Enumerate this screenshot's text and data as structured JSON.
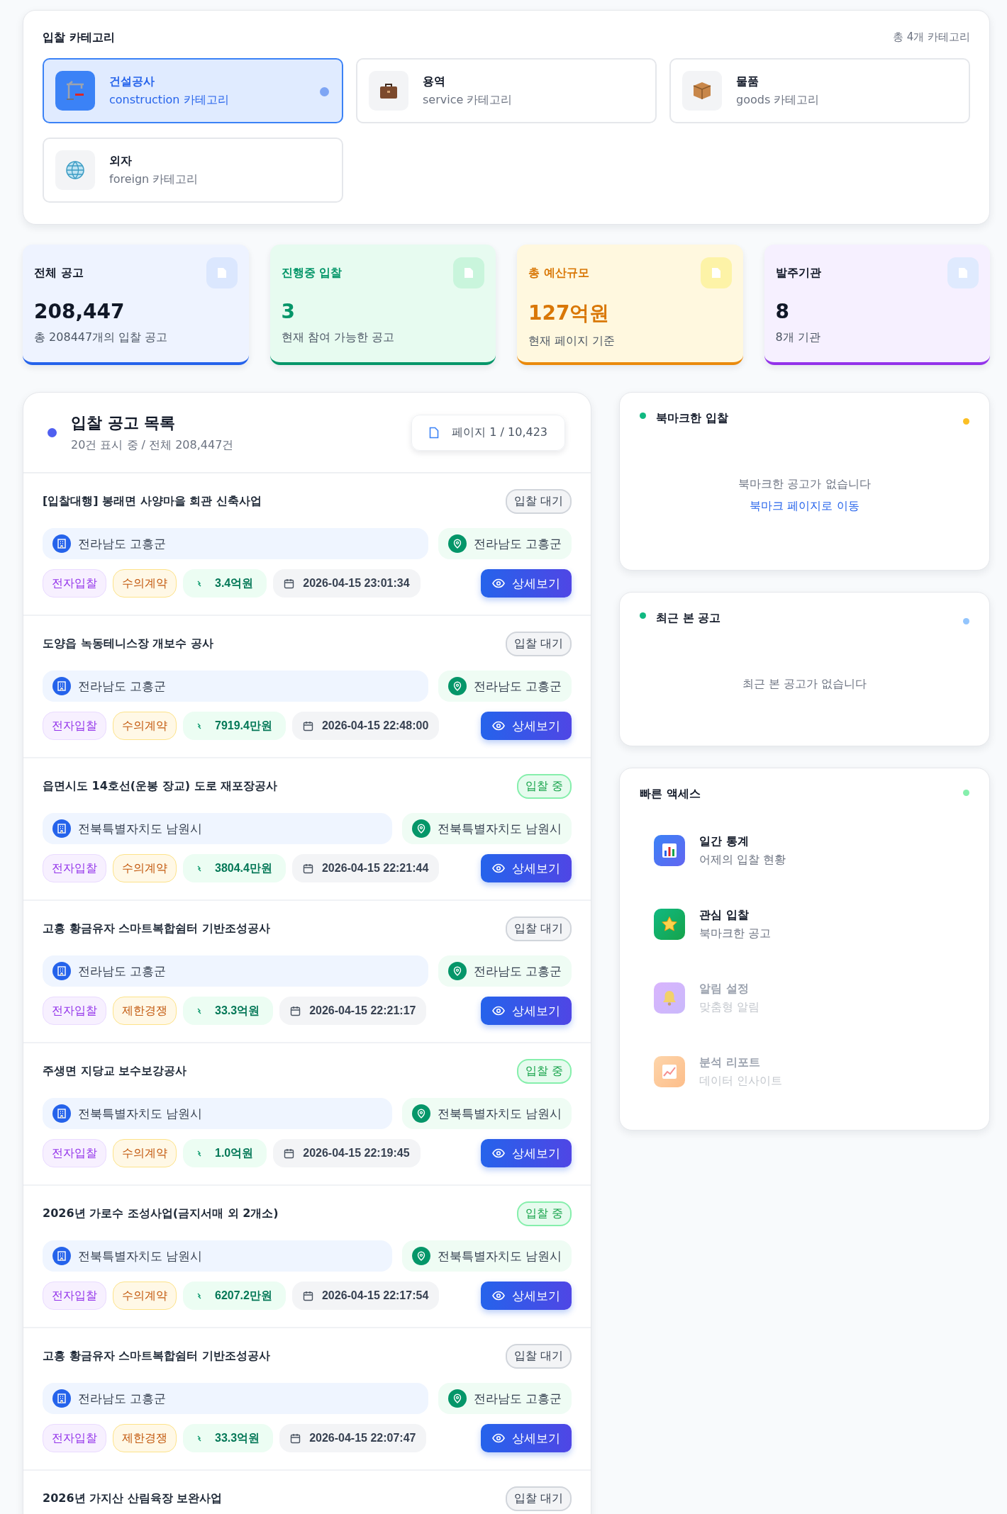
{
  "categories": {
    "title": "입찰 카테고리",
    "total": "총 4개 카테고리",
    "items": [
      {
        "kind": "construction",
        "name": "건설공사",
        "sub": "construction 카테고리",
        "selected": true
      },
      {
        "kind": "service",
        "name": "용역",
        "sub": "service 카테고리",
        "selected": false
      },
      {
        "kind": "goods",
        "name": "물품",
        "sub": "goods 카테고리",
        "selected": false
      },
      {
        "kind": "foreign",
        "name": "외자",
        "sub": "foreign 카테고리",
        "selected": false
      }
    ]
  },
  "stats": [
    {
      "kind": "blue",
      "label": "전체 공고",
      "value": "208,447",
      "sub": "총 208447개의 입찰 공고"
    },
    {
      "kind": "green",
      "label": "진행중 입찰",
      "value": "3",
      "sub": "현재 참여 가능한 공고"
    },
    {
      "kind": "amber",
      "label": "총 예산규모",
      "value": "127억원",
      "sub": "현재 페이지 기준"
    },
    {
      "kind": "purple",
      "label": "발주기관",
      "value": "8",
      "sub": "8개 기관"
    }
  ],
  "list": {
    "title": "입찰 공고 목록",
    "summary": "20건 표시 중 / 전체 208,447건",
    "page": "페이지 1 / 10,423",
    "rows": [
      {
        "title": "[입찰대행] 봉래면 사양마을 회관 신축사업",
        "status": {
          "kind": "waiting",
          "label": "입찰 대기"
        },
        "agency": "전라남도 고흥군",
        "region": "전라남도 고흥군",
        "method": "전자입찰",
        "contract": "수의계약",
        "amount": "3.4억원",
        "date": "2026-04-15 23:01:34",
        "detail_label": "상세보기"
      },
      {
        "title": "도양읍 녹동테니스장 개보수 공사",
        "status": {
          "kind": "waiting",
          "label": "입찰 대기"
        },
        "agency": "전라남도 고흥군",
        "region": "전라남도 고흥군",
        "method": "전자입찰",
        "contract": "수의계약",
        "amount": "7919.4만원",
        "date": "2026-04-15 22:48:00",
        "detail_label": "상세보기"
      },
      {
        "title": "읍면시도 14호선(운봉 장교) 도로 재포장공사",
        "status": {
          "kind": "open",
          "label": "입찰 중"
        },
        "agency": "전북특별자치도 남원시",
        "region": "전북특별자치도 남원시",
        "method": "전자입찰",
        "contract": "수의계약",
        "amount": "3804.4만원",
        "date": "2026-04-15 22:21:44",
        "detail_label": "상세보기"
      },
      {
        "title": "고흥 황금유자 스마트복합쉼터 기반조성공사",
        "status": {
          "kind": "waiting",
          "label": "입찰 대기"
        },
        "agency": "전라남도 고흥군",
        "region": "전라남도 고흥군",
        "method": "전자입찰",
        "contract": "제한경쟁",
        "amount": "33.3억원",
        "date": "2026-04-15 22:21:17",
        "detail_label": "상세보기"
      },
      {
        "title": "주생면 지당교 보수보강공사",
        "status": {
          "kind": "open",
          "label": "입찰 중"
        },
        "agency": "전북특별자치도 남원시",
        "region": "전북특별자치도 남원시",
        "method": "전자입찰",
        "contract": "수의계약",
        "amount": "1.0억원",
        "date": "2026-04-15 22:19:45",
        "detail_label": "상세보기"
      },
      {
        "title": "2026년 가로수 조성사업(금지서매 외 2개소)",
        "status": {
          "kind": "open",
          "label": "입찰 중"
        },
        "agency": "전북특별자치도 남원시",
        "region": "전북특별자치도 남원시",
        "method": "전자입찰",
        "contract": "수의계약",
        "amount": "6207.2만원",
        "date": "2026-04-15 22:17:54",
        "detail_label": "상세보기"
      },
      {
        "title": "고흥 황금유자 스마트복합쉼터 기반조성공사",
        "status": {
          "kind": "waiting",
          "label": "입찰 대기"
        },
        "agency": "전라남도 고흥군",
        "region": "전라남도 고흥군",
        "method": "전자입찰",
        "contract": "제한경쟁",
        "amount": "33.3억원",
        "date": "2026-04-15 22:07:47",
        "detail_label": "상세보기"
      },
      {
        "title": "2026년 가지산 산림육장 보완사업",
        "status": {
          "kind": "waiting",
          "label": "입찰 대기"
        }
      }
    ]
  },
  "bookmarks": {
    "title": "북마크한 입찰",
    "color": "#fbbf24",
    "empty": "북마크한 공고가 없습니다",
    "link": "북마크 페이지로 이동"
  },
  "recent": {
    "title": "최근 본 공고",
    "color": "#93c5fd",
    "empty": "최근 본 공고가 없습니다"
  },
  "quick": {
    "title": "빠른 액세스",
    "color": "#86efac",
    "items": [
      {
        "kind": "stats",
        "title": "일간 통계",
        "sub": "어제의 입찰 현황",
        "disabled": false
      },
      {
        "kind": "star",
        "title": "관심 입찰",
        "sub": "북마크한 공고",
        "disabled": false
      },
      {
        "kind": "bell",
        "title": "알림 설정",
        "sub": "맞춤형 알림",
        "disabled": true
      },
      {
        "kind": "report",
        "title": "분석 리포트",
        "sub": "데이터 인사이트",
        "disabled": true
      }
    ]
  }
}
